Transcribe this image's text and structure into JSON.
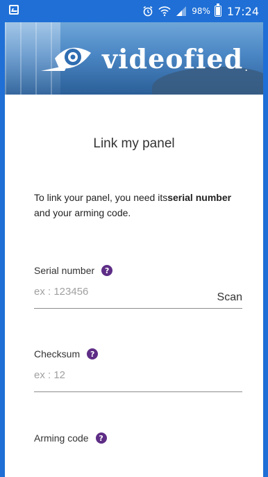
{
  "status_bar": {
    "battery_percent": "98%",
    "time": "17:24",
    "icons": [
      "image-notification-icon",
      "alarm-icon",
      "wifi-icon",
      "signal-icon",
      "battery-icon"
    ]
  },
  "header": {
    "logo_text": "videofied",
    "logo_mark": "eye-logo-icon",
    "brand_color": "#1f6fd6"
  },
  "page": {
    "title": "Link my panel",
    "intro_part1": "To link your panel, you need its",
    "intro_bold": "serial number",
    "intro_part2": " and your arming code."
  },
  "fields": {
    "serial": {
      "label": "Serial number",
      "placeholder": "ex : 123456",
      "scan_label": "Scan"
    },
    "checksum": {
      "label": "Checksum",
      "placeholder": "ex : 12"
    },
    "arming": {
      "label": "Arming code"
    },
    "help_glyph": "?"
  },
  "colors": {
    "help_icon": "#5e2d86",
    "frame": "#1f6fd6"
  }
}
